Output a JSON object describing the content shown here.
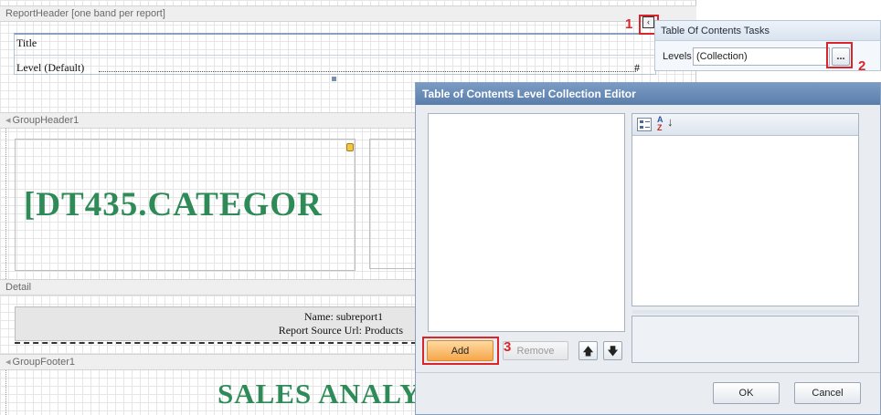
{
  "designer": {
    "report_header": {
      "label": "ReportHeader [one band per report]",
      "title_text": "Title",
      "level_text": "Level (Default)",
      "page_placeholder": "#"
    },
    "group_header": {
      "label": "GroupHeader1",
      "category_field": "[DT435.CATEGOR"
    },
    "detail": {
      "label": "Detail",
      "subreport_name": "Name: subreport1",
      "subreport_source": "Report Source Url: Products"
    },
    "group_footer": {
      "label": "GroupFooter1",
      "sales_text": "SALES ANALYS"
    }
  },
  "tasks_panel": {
    "title": "Table Of Contents Tasks",
    "levels_label": "Levels",
    "levels_value": "(Collection)",
    "ellipsis_label": "..."
  },
  "callouts": {
    "one": "1",
    "two": "2",
    "three": "3"
  },
  "dialog": {
    "title": "Table of Contents Level Collection Editor",
    "add_label": "Add",
    "remove_label": "Remove",
    "ok_label": "OK",
    "cancel_label": "Cancel",
    "sort_label": "A Z"
  },
  "icons": {
    "smart_tag": "chevron-left-icon",
    "categorized": "categorized-icon",
    "alphabetical": "alphabetical-sort-icon",
    "move_up": "arrow-up-icon",
    "move_down": "arrow-down-icon"
  },
  "colors": {
    "accent_red": "#d9262c",
    "field_green": "#2e8b57",
    "dialog_title": "#5a7eab",
    "add_button": "#f6a64b"
  }
}
